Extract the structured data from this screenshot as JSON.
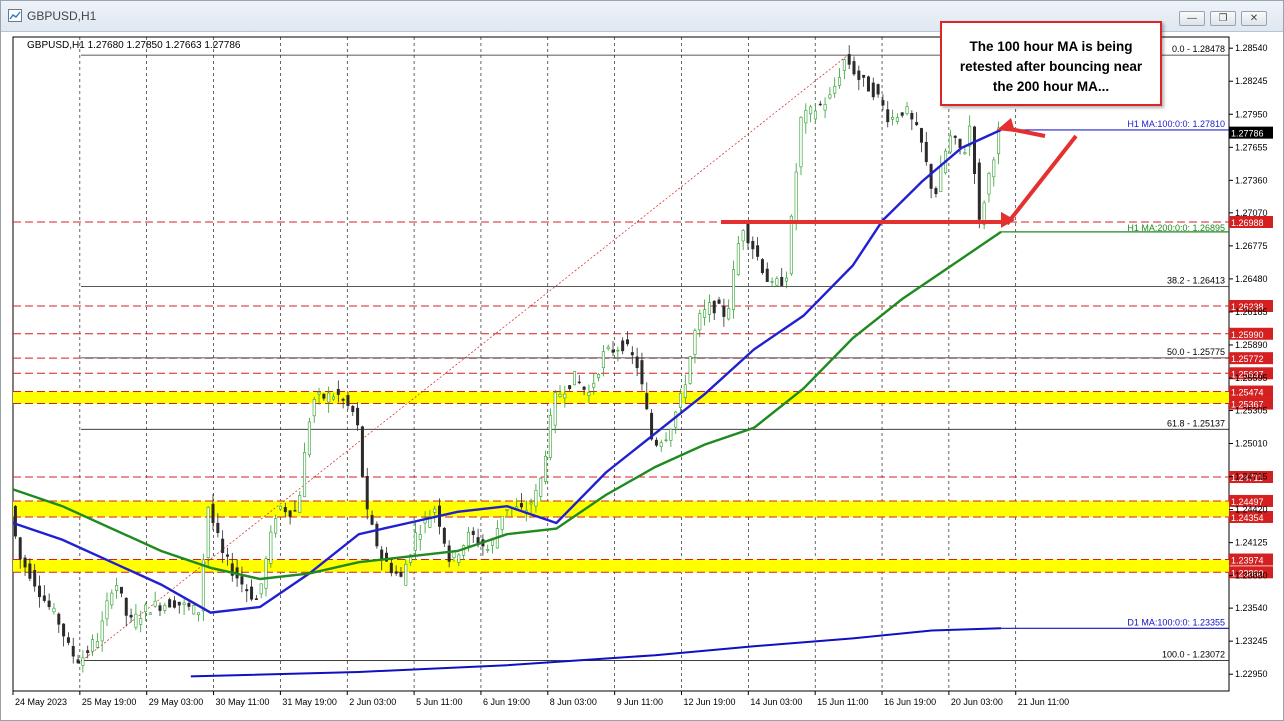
{
  "window": {
    "title": "GBPUSD,H1",
    "icons": [
      "chart-app-icon",
      "minimize-icon",
      "restore-icon",
      "close-icon"
    ]
  },
  "info_line": "GBPUSD,H1  1.27680 1.27850 1.27663 1.27786",
  "callout": {
    "text": "The 100 hour MA is being retested after bouncing near the 200 hour MA...",
    "color": "#e02424"
  },
  "colors": {
    "bull_candle": "#2ea02e",
    "bear_candle": "#2a2a2a",
    "ma100": "#2020d0",
    "ma200": "#1f8a1f",
    "d1_ma": "#1010c0",
    "level_line": "#d42020",
    "zone": "#ffff00",
    "price_tag": "#d42020",
    "current_tag": "#000000"
  },
  "chart_data": {
    "type": "line",
    "title": "GBPUSD,H1",
    "ohlc_last": {
      "open": 1.2768,
      "high": 1.2785,
      "low": 1.27663,
      "close": 1.27786
    },
    "ylim": [
      1.228,
      1.2864
    ],
    "y_ticks": [
      "1.28540",
      "1.28245",
      "1.27950",
      "1.27655",
      "1.27360",
      "1.27070",
      "1.26775",
      "1.26480",
      "1.26185",
      "1.25890",
      "1.25595",
      "1.25305",
      "1.25010",
      "1.24715",
      "1.24420",
      "1.24125",
      "1.23830",
      "1.23540",
      "1.23245",
      "1.22950"
    ],
    "x_ticks": [
      "24 May 2023",
      "25 May 19:00",
      "29 May 03:00",
      "30 May 11:00",
      "31 May 19:00",
      "2 Jun 03:00",
      "5 Jun 11:00",
      "6 Jun 19:00",
      "8 Jun 03:00",
      "9 Jun 11:00",
      "12 Jun 19:00",
      "14 Jun 03:00",
      "15 Jun 11:00",
      "16 Jun 19:00",
      "20 Jun 03:00",
      "21 Jun 11:00"
    ],
    "x_extent": 1.0,
    "price_path": [
      [
        0.0,
        1.2445
      ],
      [
        0.008,
        1.24
      ],
      [
        0.02,
        1.2385
      ],
      [
        0.035,
        1.236
      ],
      [
        0.05,
        1.234
      ],
      [
        0.06,
        1.2315
      ],
      [
        0.07,
        1.2307
      ],
      [
        0.09,
        1.233
      ],
      [
        0.105,
        1.2382
      ],
      [
        0.12,
        1.234
      ],
      [
        0.14,
        1.2355
      ],
      [
        0.165,
        1.236
      ],
      [
        0.19,
        1.235
      ],
      [
        0.2,
        1.2445
      ],
      [
        0.215,
        1.24
      ],
      [
        0.235,
        1.2375
      ],
      [
        0.25,
        1.236
      ],
      [
        0.27,
        1.2445
      ],
      [
        0.29,
        1.244
      ],
      [
        0.305,
        1.254
      ],
      [
        0.33,
        1.2545
      ],
      [
        0.35,
        1.2525
      ],
      [
        0.36,
        1.244
      ],
      [
        0.375,
        1.24
      ],
      [
        0.395,
        1.238
      ],
      [
        0.41,
        1.242
      ],
      [
        0.43,
        1.2445
      ],
      [
        0.445,
        1.2395
      ],
      [
        0.465,
        1.242
      ],
      [
        0.485,
        1.2405
      ],
      [
        0.5,
        1.2445
      ],
      [
        0.52,
        1.244
      ],
      [
        0.535,
        1.246
      ],
      [
        0.55,
        1.254
      ],
      [
        0.57,
        1.256
      ],
      [
        0.585,
        1.2545
      ],
      [
        0.6,
        1.258
      ],
      [
        0.62,
        1.259
      ],
      [
        0.635,
        1.257
      ],
      [
        0.65,
        1.25
      ],
      [
        0.665,
        1.251
      ],
      [
        0.68,
        1.2545
      ],
      [
        0.695,
        1.261
      ],
      [
        0.71,
        1.2625
      ],
      [
        0.725,
        1.2615
      ],
      [
        0.74,
        1.2698
      ],
      [
        0.755,
        1.267
      ],
      [
        0.77,
        1.264
      ],
      [
        0.785,
        1.265
      ],
      [
        0.8,
        1.279
      ],
      [
        0.815,
        1.28
      ],
      [
        0.83,
        1.281
      ],
      [
        0.845,
        1.2846
      ],
      [
        0.86,
        1.2825
      ],
      [
        0.875,
        1.2815
      ],
      [
        0.89,
        1.279
      ],
      [
        0.905,
        1.28
      ],
      [
        0.92,
        1.2775
      ],
      [
        0.935,
        1.272
      ],
      [
        0.95,
        1.2775
      ],
      [
        0.965,
        1.276
      ],
      [
        0.972,
        1.279
      ],
      [
        0.98,
        1.2695
      ],
      [
        0.99,
        1.274
      ],
      [
        1.0,
        1.2779
      ]
    ],
    "series": [
      {
        "name": "H1 MA:100:0:0: 1.27810",
        "values": [
          [
            0.0,
            1.243
          ],
          [
            0.05,
            1.2415
          ],
          [
            0.1,
            1.2395
          ],
          [
            0.15,
            1.2375
          ],
          [
            0.2,
            1.235
          ],
          [
            0.25,
            1.2355
          ],
          [
            0.3,
            1.2385
          ],
          [
            0.35,
            1.242
          ],
          [
            0.4,
            1.243
          ],
          [
            0.45,
            1.244
          ],
          [
            0.5,
            1.2445
          ],
          [
            0.55,
            1.243
          ],
          [
            0.6,
            1.2475
          ],
          [
            0.65,
            1.251
          ],
          [
            0.7,
            1.2545
          ],
          [
            0.75,
            1.2585
          ],
          [
            0.8,
            1.2615
          ],
          [
            0.85,
            1.266
          ],
          [
            0.88,
            1.27
          ],
          [
            0.92,
            1.2735
          ],
          [
            0.96,
            1.2765
          ],
          [
            1.0,
            1.2781
          ]
        ]
      },
      {
        "name": "H1 MA:200:0:0: 1.26895",
        "values": [
          [
            0.0,
            1.246
          ],
          [
            0.05,
            1.2445
          ],
          [
            0.1,
            1.2425
          ],
          [
            0.15,
            1.2405
          ],
          [
            0.2,
            1.239
          ],
          [
            0.25,
            1.238
          ],
          [
            0.3,
            1.2385
          ],
          [
            0.35,
            1.2395
          ],
          [
            0.4,
            1.24
          ],
          [
            0.45,
            1.2405
          ],
          [
            0.5,
            1.242
          ],
          [
            0.55,
            1.2425
          ],
          [
            0.6,
            1.2455
          ],
          [
            0.65,
            1.248
          ],
          [
            0.7,
            1.25
          ],
          [
            0.75,
            1.2515
          ],
          [
            0.8,
            1.255
          ],
          [
            0.85,
            1.2595
          ],
          [
            0.9,
            1.263
          ],
          [
            0.95,
            1.266
          ],
          [
            1.0,
            1.269
          ]
        ]
      },
      {
        "name": "D1 MA:100:0:0: 1.23355",
        "values": [
          [
            0.18,
            1.2293
          ],
          [
            0.35,
            1.2297
          ],
          [
            0.5,
            1.2303
          ],
          [
            0.65,
            1.2312
          ],
          [
            0.75,
            1.232
          ],
          [
            0.85,
            1.2327
          ],
          [
            0.93,
            1.2334
          ],
          [
            1.0,
            1.2336
          ]
        ]
      }
    ],
    "current_price": "1.27786",
    "horizontal_levels": [
      {
        "price": 1.26988,
        "label": "1.26988"
      },
      {
        "price": 1.26238,
        "label": "1.26238"
      },
      {
        "price": 1.2599,
        "label": "1.25990"
      },
      {
        "price": 1.25772,
        "label": "1.25772"
      },
      {
        "price": 1.25637,
        "label": "1.25637"
      },
      {
        "price": 1.25474,
        "label": "1.25474"
      },
      {
        "price": 1.25367,
        "label": "1.25367"
      },
      {
        "price": 1.24711,
        "label": "1.24711"
      },
      {
        "price": 1.24497,
        "label": "1.24497"
      },
      {
        "price": 1.24354,
        "label": "1.24354"
      },
      {
        "price": 1.23974,
        "label": "1.23974"
      },
      {
        "price": 1.2386,
        "label": "1.23860"
      }
    ],
    "zones": [
      {
        "from": 1.25367,
        "to": 1.25474
      },
      {
        "from": 1.24354,
        "to": 1.24497
      },
      {
        "from": 1.2386,
        "to": 1.23974
      }
    ],
    "fibonacci": [
      {
        "label": "0.0 - 1.28478",
        "price": 1.28478
      },
      {
        "label": "38.2 - 1.26413",
        "price": 1.26413
      },
      {
        "label": "50.0 - 1.25775",
        "price": 1.25775
      },
      {
        "label": "61.8 - 1.25137",
        "price": 1.25137
      },
      {
        "label": "100.0 - 1.23072",
        "price": 1.23072
      }
    ],
    "ma_labels": {
      "ma100": "H1 MA:100:0:0: 1.27810",
      "ma200": "H1 MA:200:0:0: 1.26895",
      "d1": "D1 MA:100:0:0: 1.23355"
    }
  }
}
